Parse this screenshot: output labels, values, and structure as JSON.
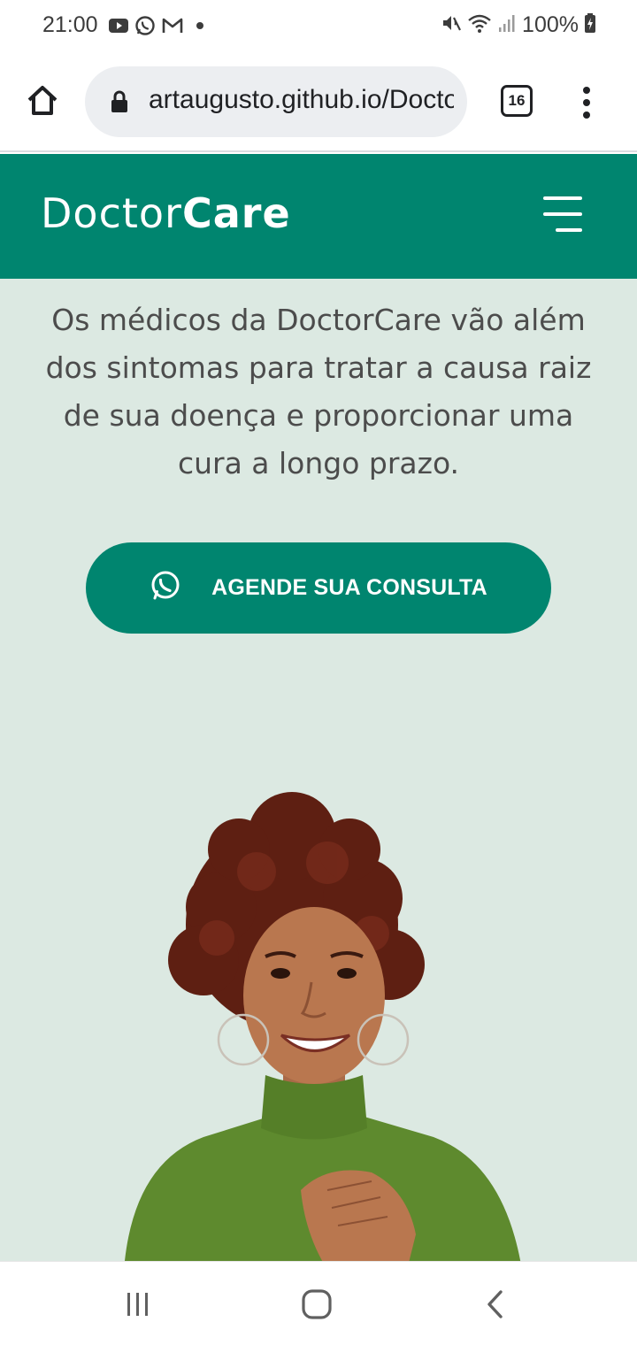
{
  "status_bar": {
    "time": "21:00",
    "left_icons": [
      "youtube-icon",
      "whatsapp-icon",
      "gmail-icon",
      "dot-icon"
    ],
    "right_icons": [
      "mute-icon",
      "wifi-icon",
      "signal-icon"
    ],
    "battery": "100%"
  },
  "browser": {
    "url": "artaugusto.github.io/DoctorCare",
    "tab_count": "16"
  },
  "header": {
    "logo_regular": "Doctor",
    "logo_bold": "Care"
  },
  "hero": {
    "description": "Os médicos da DoctorCare vão além dos sintomas para tratar a causa raiz de sua doença e proporcionar uma cura a longo prazo.",
    "cta_label": "AGENDE SUA CONSULTA"
  },
  "colors": {
    "brand_green": "#00856f",
    "hero_background": "#dce9e2",
    "text_gray": "#4c4c4c"
  }
}
